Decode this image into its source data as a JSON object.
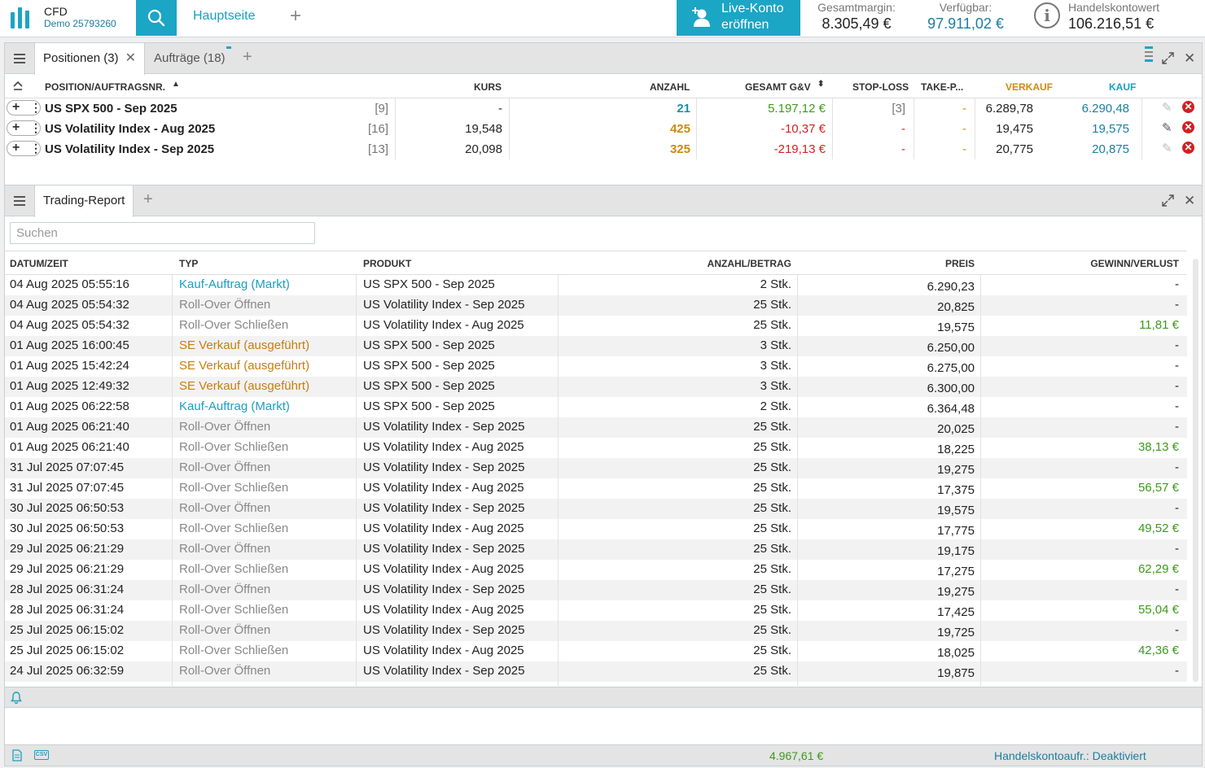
{
  "header": {
    "brand_title": "CFD",
    "brand_sub": "Demo 25793260",
    "home_tab": "Hauptseite",
    "add_tab": "+",
    "live_btn_line1": "Live-Konto",
    "live_btn_line2": "eröffnen",
    "stats": [
      {
        "label": "Gesamtmargin:",
        "value": "8.305,49 €"
      },
      {
        "label": "Verfügbar:",
        "value": "97.911,02 €"
      },
      {
        "label": "Handelskontowert",
        "value": "106.216,51 €"
      }
    ],
    "accent_color": "#1aa6c4"
  },
  "positions_panel": {
    "tabs": [
      {
        "label": "Positionen (3)"
      },
      {
        "label": "Aufträge (18)"
      }
    ],
    "columns": [
      "POSITION/AUFTRAGSNR.",
      "KURS",
      "ANZAHL",
      "GESAMT G&V",
      "STOP-LOSS",
      "TAKE-P...",
      "VERKAUF",
      "KAUF"
    ],
    "rows": [
      {
        "name": "US SPX 500 - Sep 2025",
        "id": "[9]",
        "kurs": "-",
        "anzahl": "21",
        "gv": "5.197,12 €",
        "sl": "[3]",
        "tp": "-",
        "verkauf": "6.289,78",
        "kauf": "6.290,48"
      },
      {
        "name": "US Volatility Index - Aug 2025",
        "id": "[16]",
        "kurs": "19,548",
        "anzahl": "425",
        "gv": "-10,37 €",
        "sl": "-",
        "tp": "-",
        "verkauf": "19,475",
        "kauf": "19,575"
      },
      {
        "name": "US Volatility Index - Sep 2025",
        "id": "[13]",
        "kurs": "20,098",
        "anzahl": "325",
        "gv": "-219,13 €",
        "sl": "-",
        "tp": "-",
        "verkauf": "20,775",
        "kauf": "20,875"
      }
    ]
  },
  "report_panel": {
    "tab": "Trading-Report",
    "search_placeholder": "Suchen",
    "columns": [
      "DATUM/ZEIT",
      "TYP",
      "PRODUKT",
      "ANZAHL/BETRAG",
      "PREIS",
      "GEWINN/VERLUST"
    ],
    "rows": [
      {
        "date": "04 Aug 2025 05:55:16",
        "typ": "Kauf-Auftrag (Markt)",
        "kind": "blue",
        "produkt": "US SPX 500 - Sep 2025",
        "anzahl": "2 Stk.",
        "preis": "6.290,23",
        "gv": "-"
      },
      {
        "date": "04 Aug 2025 05:54:32",
        "typ": "Roll-Over Öffnen",
        "kind": "grey",
        "produkt": "US Volatility Index - Sep 2025",
        "anzahl": "25 Stk.",
        "preis": "20,825",
        "gv": "-"
      },
      {
        "date": "04 Aug 2025 05:54:32",
        "typ": "Roll-Over Schließen",
        "kind": "grey",
        "produkt": "US Volatility Index - Aug 2025",
        "anzahl": "25 Stk.",
        "preis": "19,575",
        "gv": "11,81 €"
      },
      {
        "date": "01 Aug 2025 16:00:45",
        "typ": "SE Verkauf (ausgeführt)",
        "kind": "orange",
        "produkt": "US SPX 500 - Sep 2025",
        "anzahl": "3 Stk.",
        "preis": "6.250,00",
        "gv": "-"
      },
      {
        "date": "01 Aug 2025 15:42:24",
        "typ": "SE Verkauf (ausgeführt)",
        "kind": "orange",
        "produkt": "US SPX 500 - Sep 2025",
        "anzahl": "3 Stk.",
        "preis": "6.275,00",
        "gv": "-"
      },
      {
        "date": "01 Aug 2025 12:49:32",
        "typ": "SE Verkauf (ausgeführt)",
        "kind": "orange",
        "produkt": "US SPX 500 - Sep 2025",
        "anzahl": "3 Stk.",
        "preis": "6.300,00",
        "gv": "-"
      },
      {
        "date": "01 Aug 2025 06:22:58",
        "typ": "Kauf-Auftrag (Markt)",
        "kind": "blue",
        "produkt": "US SPX 500 - Sep 2025",
        "anzahl": "2 Stk.",
        "preis": "6.364,48",
        "gv": "-"
      },
      {
        "date": "01 Aug 2025 06:21:40",
        "typ": "Roll-Over Öffnen",
        "kind": "grey",
        "produkt": "US Volatility Index - Sep 2025",
        "anzahl": "25 Stk.",
        "preis": "20,025",
        "gv": "-"
      },
      {
        "date": "01 Aug 2025 06:21:40",
        "typ": "Roll-Over Schließen",
        "kind": "grey",
        "produkt": "US Volatility Index - Aug 2025",
        "anzahl": "25 Stk.",
        "preis": "18,225",
        "gv": "38,13 €"
      },
      {
        "date": "31 Jul 2025 07:07:45",
        "typ": "Roll-Over Öffnen",
        "kind": "grey",
        "produkt": "US Volatility Index - Sep 2025",
        "anzahl": "25 Stk.",
        "preis": "19,275",
        "gv": "-"
      },
      {
        "date": "31 Jul 2025 07:07:45",
        "typ": "Roll-Over Schließen",
        "kind": "grey",
        "produkt": "US Volatility Index - Aug 2025",
        "anzahl": "25 Stk.",
        "preis": "17,375",
        "gv": "56,57 €"
      },
      {
        "date": "30 Jul 2025 06:50:53",
        "typ": "Roll-Over Öffnen",
        "kind": "grey",
        "produkt": "US Volatility Index - Sep 2025",
        "anzahl": "25 Stk.",
        "preis": "19,575",
        "gv": "-"
      },
      {
        "date": "30 Jul 2025 06:50:53",
        "typ": "Roll-Over Schließen",
        "kind": "grey",
        "produkt": "US Volatility Index - Aug 2025",
        "anzahl": "25 Stk.",
        "preis": "17,775",
        "gv": "49,52 €"
      },
      {
        "date": "29 Jul 2025 06:21:29",
        "typ": "Roll-Over Öffnen",
        "kind": "grey",
        "produkt": "US Volatility Index - Sep 2025",
        "anzahl": "25 Stk.",
        "preis": "19,175",
        "gv": "-"
      },
      {
        "date": "29 Jul 2025 06:21:29",
        "typ": "Roll-Over Schließen",
        "kind": "grey",
        "produkt": "US Volatility Index - Aug 2025",
        "anzahl": "25 Stk.",
        "preis": "17,275",
        "gv": "62,29 €"
      },
      {
        "date": "28 Jul 2025 06:31:24",
        "typ": "Roll-Over Öffnen",
        "kind": "grey",
        "produkt": "US Volatility Index - Sep 2025",
        "anzahl": "25 Stk.",
        "preis": "19,275",
        "gv": "-"
      },
      {
        "date": "28 Jul 2025 06:31:24",
        "typ": "Roll-Over Schließen",
        "kind": "grey",
        "produkt": "US Volatility Index - Aug 2025",
        "anzahl": "25 Stk.",
        "preis": "17,425",
        "gv": "55,04 €"
      },
      {
        "date": "25 Jul 2025 06:15:02",
        "typ": "Roll-Over Öffnen",
        "kind": "grey",
        "produkt": "US Volatility Index - Sep 2025",
        "anzahl": "25 Stk.",
        "preis": "19,725",
        "gv": "-"
      },
      {
        "date": "25 Jul 2025 06:15:02",
        "typ": "Roll-Over Schließen",
        "kind": "grey",
        "produkt": "US Volatility Index - Aug 2025",
        "anzahl": "25 Stk.",
        "preis": "18,025",
        "gv": "42,36 €"
      },
      {
        "date": "24 Jul 2025 06:32:59",
        "typ": "Roll-Over Öffnen",
        "kind": "grey",
        "produkt": "US Volatility Index - Sep 2025",
        "anzahl": "25 Stk.",
        "preis": "19,875",
        "gv": "-"
      }
    ]
  },
  "footer": {
    "total": "4.967,61 €",
    "status": "Handelskontoaufr.: Deaktiviert"
  }
}
